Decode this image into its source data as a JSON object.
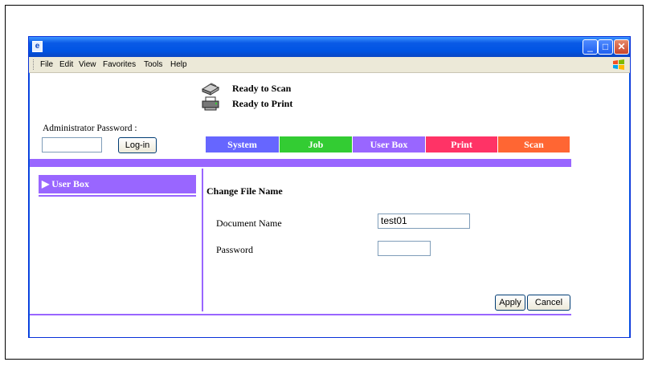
{
  "menubar": {
    "items": [
      "File",
      "Edit",
      "View",
      "Favorites",
      "Tools",
      "Help"
    ]
  },
  "status": {
    "scan": "Ready to Scan",
    "print": "Ready to Print"
  },
  "admin": {
    "label": "Administrator Password :",
    "password_value": "",
    "login_label": "Log-in"
  },
  "tabs": [
    {
      "label": "System",
      "color": "#6666ff"
    },
    {
      "label": "Job",
      "color": "#33cc33"
    },
    {
      "label": "User Box",
      "color": "#9966ff"
    },
    {
      "label": "Print",
      "color": "#ff3366"
    },
    {
      "label": "Scan",
      "color": "#ff6633"
    }
  ],
  "sidebar": {
    "items": [
      {
        "label": "▶ User Box",
        "active": true
      }
    ]
  },
  "form": {
    "title": "Change File Name",
    "document_name_label": "Document Name",
    "document_name_value": "test01",
    "password_label": "Password",
    "password_value": ""
  },
  "actions": {
    "apply": "Apply",
    "cancel": "Cancel"
  },
  "colors": {
    "accent": "#9966ff",
    "titlebar": "#0a5ae6"
  }
}
